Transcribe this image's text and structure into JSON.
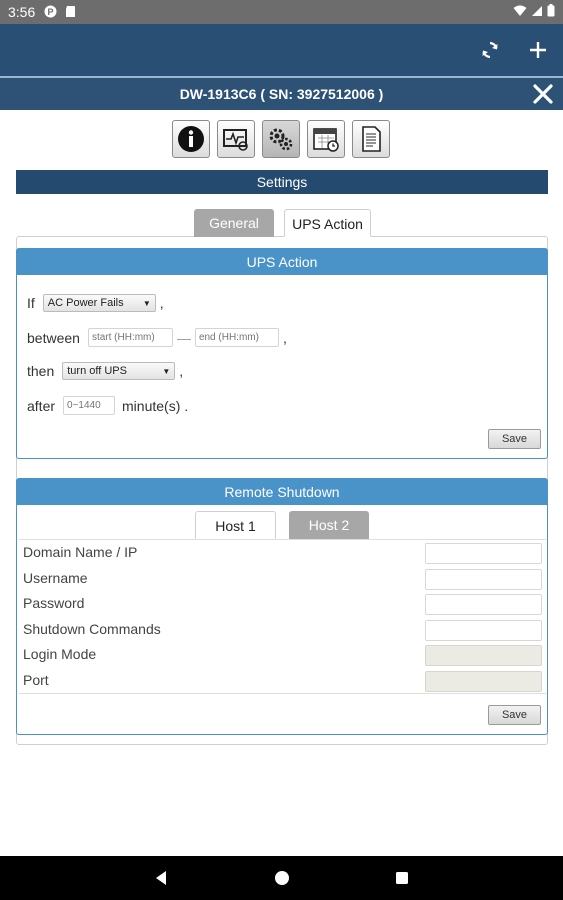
{
  "status_bar": {
    "time": "3:56"
  },
  "window": {
    "title": "DW-1913C6 ( SN: 3927512006 )"
  },
  "toolbar": {
    "buttons": [
      "info-icon",
      "monitor-icon",
      "settings-gears-icon",
      "schedule-calendar-icon",
      "log-document-icon"
    ]
  },
  "settings_header": "Settings",
  "tabs": {
    "general": "General",
    "ups_action": "UPS Action"
  },
  "ups_action": {
    "header": "UPS Action",
    "if_label": "If",
    "condition_value": "AC Power Fails",
    "between_label": "between",
    "start_placeholder": "start (HH:mm)",
    "dash": "—",
    "end_placeholder": "end (HH:mm)",
    "comma": ",",
    "then_label": "then",
    "action_value": "turn off UPS",
    "after_label": "after",
    "minutes_placeholder": "0~1440",
    "minutes_unit": "minute(s) .",
    "save": "Save"
  },
  "remote_shutdown": {
    "header": "Remote Shutdown",
    "tabs": {
      "host1": "Host 1",
      "host2": "Host 2"
    },
    "fields": [
      {
        "label": "Domain Name / IP",
        "disabled": false
      },
      {
        "label": "Username",
        "disabled": false
      },
      {
        "label": "Password",
        "disabled": false
      },
      {
        "label": "Shutdown Commands",
        "disabled": false
      },
      {
        "label": "Login Mode",
        "disabled": true
      },
      {
        "label": "Port",
        "disabled": true
      }
    ],
    "save": "Save"
  },
  "colors": {
    "app_bar": "#2a4f74",
    "panel_header": "#4a93c8",
    "settings_bar": "#244a70"
  }
}
